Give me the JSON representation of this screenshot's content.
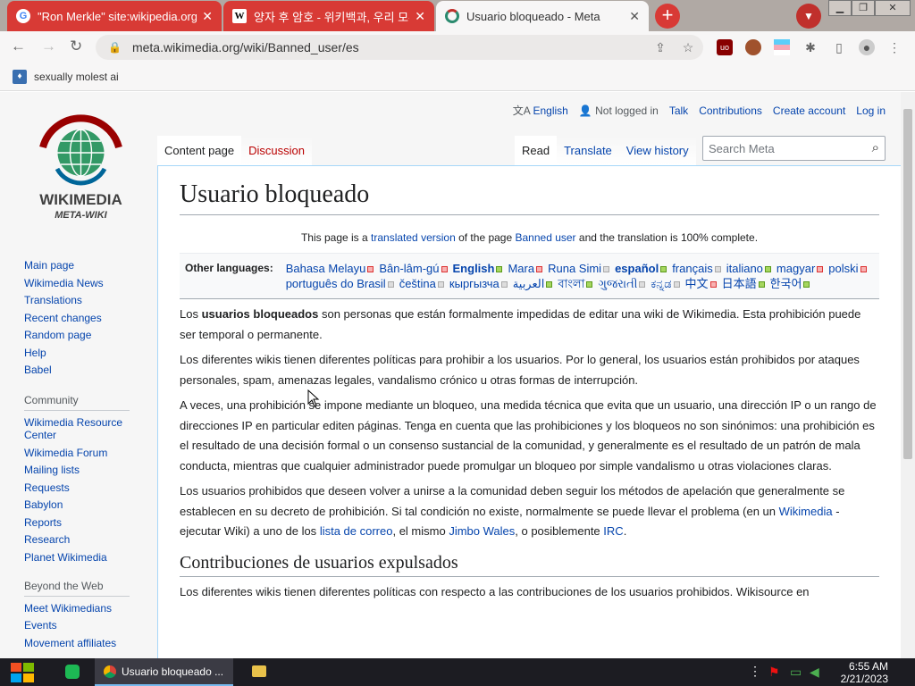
{
  "browser": {
    "tabs": [
      {
        "title": "\"Ron Merkle\" site:wikipedia.org",
        "favicon": "google-icon"
      },
      {
        "title": "양자 후 암호 - 위키백과, 우리 모두의",
        "favicon": "wikipedia-icon"
      },
      {
        "title": "Usuario bloqueado - Meta",
        "favicon": "wikimedia-icon"
      }
    ],
    "url": "meta.wikimedia.org/wiki/Banned_user/es",
    "bookmark": "sexually molest ai"
  },
  "header": {
    "language": "English",
    "not_logged_in": "Not logged in",
    "talk": "Talk",
    "contributions": "Contributions",
    "create_account": "Create account",
    "login": "Log in"
  },
  "logo": {
    "name": "WIKIMEDIA",
    "sub": "META-WIKI"
  },
  "page_tabs": {
    "content": "Content page",
    "discussion": "Discussion",
    "read": "Read",
    "translate": "Translate",
    "history": "View history",
    "search_placeholder": "Search Meta"
  },
  "sidebar": {
    "nav": [
      "Main page",
      "Wikimedia News",
      "Translations",
      "Recent changes",
      "Random page",
      "Help",
      "Babel"
    ],
    "community_header": "Community",
    "community": [
      "Wikimedia Resource Center",
      "Wikimedia Forum",
      "Mailing lists",
      "Requests",
      "Babylon",
      "Reports",
      "Research",
      "Planet Wikimedia"
    ],
    "beyond_header": "Beyond the Web",
    "beyond": [
      "Meet Wikimedians",
      "Events",
      "Movement affiliates"
    ]
  },
  "article": {
    "title": "Usuario bloqueado",
    "trans_prefix": "This page is a",
    "trans_link1": "translated version",
    "trans_mid": "of the page",
    "trans_link2": "Banned user",
    "trans_suffix": "and the translation is 100% complete.",
    "other_languages": "Other languages:",
    "languages": [
      {
        "name": "Bahasa Melayu",
        "status": "r"
      },
      {
        "name": "Bân-lâm-gú",
        "status": "r"
      },
      {
        "name": "English",
        "status": "bold"
      },
      {
        "name": "Mara",
        "status": "r"
      },
      {
        "name": "Runa Simi",
        "status": "gr"
      },
      {
        "name": "español",
        "status": "cur"
      },
      {
        "name": "français",
        "status": "gr"
      },
      {
        "name": "italiano",
        "status": "g"
      },
      {
        "name": "magyar",
        "status": "r"
      },
      {
        "name": "polski",
        "status": "r"
      },
      {
        "name": "português do Brasil",
        "status": "gr"
      },
      {
        "name": "čeština",
        "status": "gr"
      },
      {
        "name": "кыргызча",
        "status": "gr"
      },
      {
        "name": "العربية",
        "status": "g"
      },
      {
        "name": "বাংলা",
        "status": "g"
      },
      {
        "name": "ગુજરાતી",
        "status": "gr"
      },
      {
        "name": "ಕನ್ನಡ",
        "status": "gr"
      },
      {
        "name": "中文",
        "status": "r"
      },
      {
        "name": "日本語",
        "status": "g"
      },
      {
        "name": "한국어",
        "status": "g"
      }
    ],
    "p1_a": "Los",
    "p1_b": "usuarios bloqueados",
    "p1_c": "son personas que están formalmente impedidas de editar una wiki de Wikimedia. Esta prohibición puede ser temporal o permanente.",
    "p2": "Los diferentes wikis tienen diferentes políticas para prohibir a los usuarios. Por lo general, los usuarios están prohibidos por ataques personales, spam, amenazas legales, vandalismo crónico u otras formas de interrupción.",
    "p3": "A veces, una prohibición se impone mediante un bloqueo, una medida técnica que evita que un usuario, una dirección IP o un rango de direcciones IP en particular editen páginas. Tenga en cuenta que las prohibiciones y los bloqueos no son sinónimos: una prohibición es el resultado de una decisión formal o un consenso sustancial de la comunidad, y generalmente es el resultado de un patrón de mala conducta, mientras que cualquier administrador puede promulgar un bloqueo por simple vandalismo u otras violaciones claras.",
    "p4_a": "Los usuarios prohibidos que deseen volver a unirse a la comunidad deben seguir los métodos de apelación que generalmente se establecen en su decreto de prohibición. Si tal condición no existe, normalmente se puede llevar el problema (en un",
    "p4_link1": "Wikimedia",
    "p4_b": "- ejecutar Wiki) a uno de los",
    "p4_link2": "lista de correo",
    "p4_c": ", el mismo",
    "p4_link3": "Jimbo Wales",
    "p4_d": ", o posiblemente",
    "p4_link4": "IRC",
    "p4_e": ".",
    "h2": "Contribuciones de usuarios expulsados",
    "p5": "Los diferentes wikis tienen diferentes políticas con respecto a las contribuciones de los usuarios prohibidos. Wikisource en"
  },
  "taskbar": {
    "app": "Usuario bloqueado ...",
    "time": "6:55 AM",
    "date": "2/21/2023"
  }
}
